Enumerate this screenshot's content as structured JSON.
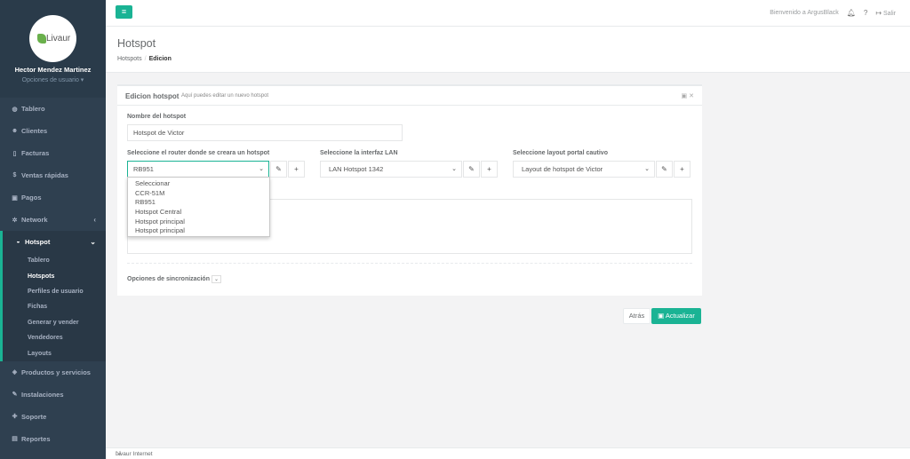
{
  "sidebar": {
    "logo_text": "Livaur",
    "user_name": "Hector Mendez Martinez",
    "user_options": "Opciones de usuario ▾",
    "items": [
      {
        "label": "Tablero",
        "icon": "dashboard-icon"
      },
      {
        "label": "Clientes",
        "icon": "users-icon"
      },
      {
        "label": "Facturas",
        "icon": "file-icon"
      },
      {
        "label": "Ventas rápidas",
        "icon": "dollar-icon"
      },
      {
        "label": "Pagos",
        "icon": "money-icon"
      },
      {
        "label": "Network",
        "icon": "network-icon"
      },
      {
        "label": "Hotspot",
        "icon": "wifi-icon"
      },
      {
        "label": "Productos y servicios",
        "icon": "tag-icon"
      },
      {
        "label": "Instalaciones",
        "icon": "wrench-icon"
      },
      {
        "label": "Soporte",
        "icon": "support-icon"
      },
      {
        "label": "Reportes",
        "icon": "report-icon"
      }
    ],
    "hotspot_sub": [
      "Tablero",
      "Hotspots",
      "Perfiles de usuario",
      "Fichas",
      "Generar y vender",
      "Vendedores",
      "Layouts"
    ]
  },
  "topbar": {
    "welcome": "Bienvenido a ArgusBlack",
    "logout": "Salir"
  },
  "page": {
    "title": "Hotspot",
    "breadcrumb_1": "Hotspots",
    "breadcrumb_2": "Edicion"
  },
  "box": {
    "title": "Edicion hotspot",
    "subtitle": "Aquí puedes editar un nuevo hotspot"
  },
  "form": {
    "name_label": "Nombre del hotspot",
    "name_value": "Hotspot de Victor",
    "router_label": "Seleccione el router donde se creara un hotspot",
    "router_value": "RB951",
    "lan_label": "Seleccione la interfaz LAN",
    "lan_value": "LAN Hotspot 1342",
    "layout_label": "Seleccione layout portal cautivo",
    "layout_value": "Layout de hotspot de Victor",
    "sync_label": "Opciones de sincronización"
  },
  "dropdown_options": [
    "Seleccionar",
    "CCR-51M",
    "RB951",
    "Hotspot Central",
    "Hotspot principal",
    "Hotspot principal"
  ],
  "buttons": {
    "back": "Atrás",
    "save": "Actualizar"
  },
  "footer": {
    "text": "Livaur Internet"
  },
  "colors": {
    "accent": "#1ab394",
    "sidebar": "#2f4050"
  }
}
